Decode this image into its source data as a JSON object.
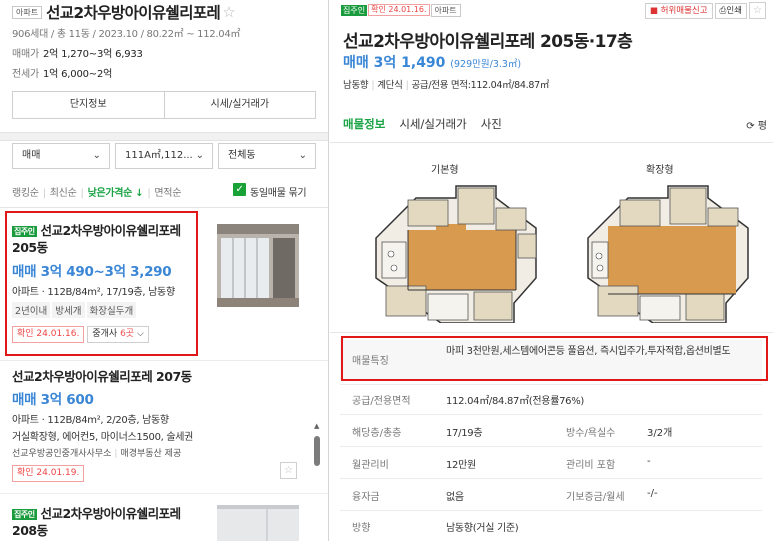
{
  "left": {
    "complex": {
      "tag": "아파트",
      "title": "선교2차우방아이유쉘리포레",
      "info": "906세대 / 총 11동 / 2023.10 / 80.22㎡ ~ 112.04㎡",
      "sale_label": "매매가",
      "sale_value": "2억 1,270~3억 6,933",
      "jeonse_label": "전세가",
      "jeonse_value": "1억 6,000~2억",
      "btn_complex": "단지정보",
      "btn_market": "시세/실거래가"
    },
    "filters": {
      "trade": "매매",
      "area": "111A㎡,112...",
      "dong": "전체동"
    },
    "sort": {
      "ranking": "랭킹순",
      "recent": "최신순",
      "low_price": "낮은가격순 ↓",
      "area": "면적순",
      "same_listing": "동일매물 묶기"
    },
    "items": [
      {
        "tag": "집주인",
        "title": "선교2차우방아이유쉘리포레 205동",
        "price": "매매 3억 490~3억 3,290",
        "info": "아파트 · 112B/84m², 17/19층, 남동향",
        "chips": [
          "2년이내",
          "방세개",
          "화장실두개"
        ],
        "verify": "확인 24.01.16.",
        "agents": "중개사 ",
        "agents_count": "6곳",
        "agents_chev": "⌵"
      },
      {
        "title": "선교2차우방아이유쉘리포레 207동",
        "price": "매매 3억 600",
        "info": "아파트 · 112B/84m², 2/20층, 남동향",
        "desc": "거실확장형, 에어컨5, 마이너스1500, 술세권",
        "agency": "선교우방공인중개사사무소",
        "provider": "매경부동산 제공",
        "verify": "확인 24.01.19."
      },
      {
        "tag": "집주인",
        "title": "선교2차우방아이유쉘리포레 208동"
      }
    ]
  },
  "right": {
    "tags": {
      "owner": "집주인",
      "verify": "확인 24.01.16.",
      "type": "아파트"
    },
    "actions": {
      "report": "허위매물신고",
      "print": "인쇄"
    },
    "title": "선교2차우방아이유쉘리포레 205동·17층",
    "price": "매매 3억 1,490",
    "price_unit": "(929만원/3.3㎡)",
    "sub": {
      "direction": "남동향",
      "structure": "계단식",
      "area": "공급/전용 면적:112.04㎡/84.87㎡"
    },
    "tabs": [
      "매물정보",
      "시세/실거래가",
      "사진"
    ],
    "refresh": "평",
    "plans": {
      "basic": "기본형",
      "extended": "확장형"
    },
    "details": {
      "feature_label": "매물특징",
      "feature_value": "마피 3천만원,세스템에어콘등 풀옵션, 즉시입주가,투자적합,옵션비별도",
      "area_label": "공급/전용면적",
      "area_value": "112.04㎡/84.87㎡(전용률76%)",
      "floor_label": "해당층/총층",
      "floor_value": "17/19층",
      "rooms_label": "방수/욕실수",
      "rooms_value": "3/2개",
      "fee_label": "월관리비",
      "fee_value": "12만원",
      "fee_inc_label": "관리비 포함",
      "fee_inc_value": "-",
      "loan_label": "융자금",
      "loan_value": "없음",
      "deposit_label": "기보증금/월세",
      "deposit_value": "-/-",
      "dir_label": "방향",
      "dir_value": "남동향(거실 기준)"
    }
  },
  "colors": {
    "accent_green": "#1aa344",
    "price_blue": "#3a86d6",
    "highlight_red": "#e01818"
  }
}
